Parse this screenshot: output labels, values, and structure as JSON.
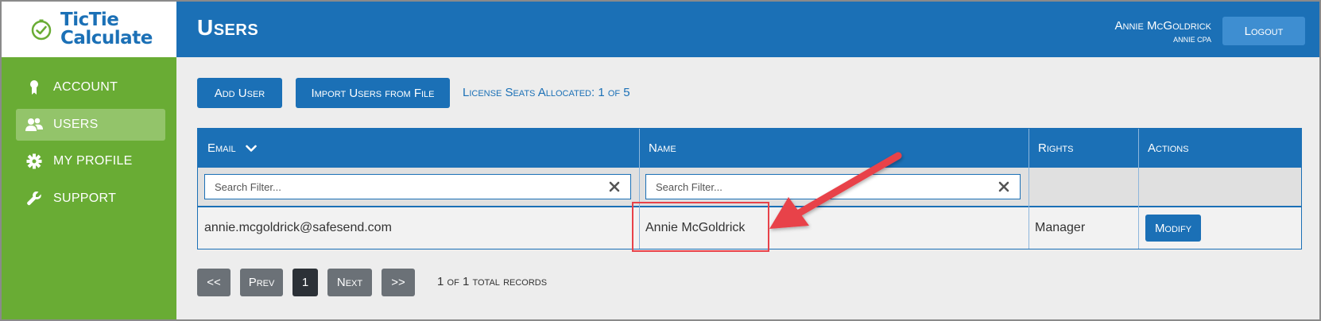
{
  "app": {
    "logo_line1": "TicTie",
    "logo_line2": "Calculate"
  },
  "sidebar": {
    "items": [
      {
        "label": "ACCOUNT",
        "icon": "award-icon",
        "active": false
      },
      {
        "label": "USERS",
        "icon": "users-icon",
        "active": true
      },
      {
        "label": "MY PROFILE",
        "icon": "gear-icon",
        "active": false
      },
      {
        "label": "SUPPORT",
        "icon": "wrench-icon",
        "active": false
      }
    ]
  },
  "header": {
    "title": "Users",
    "user_name": "Annie McGoldrick",
    "user_org": "ANNIE CPA",
    "logout_label": "Logout"
  },
  "toolbar": {
    "add_user_label": "Add User",
    "import_label": "Import Users from File",
    "license_text": "License Seats Allocated: 1 of 5"
  },
  "table": {
    "columns": [
      "Email",
      "Name",
      "Rights",
      "Actions"
    ],
    "email_filter_placeholder": "Search Filter...",
    "name_filter_placeholder": "Search Filter...",
    "rows": [
      {
        "email": "annie.mcgoldrick@safesend.com",
        "name": "Annie McGoldrick",
        "rights": "Manager",
        "action": "Modify"
      }
    ]
  },
  "pagination": {
    "first": "<<",
    "prev": "Prev",
    "current": "1",
    "next": "Next",
    "last": ">>",
    "records_text": "1 of 1 total records"
  },
  "colors": {
    "brand_blue": "#1b70b6",
    "sidebar_green": "#69ac34",
    "annotation_red": "#e8424a"
  }
}
